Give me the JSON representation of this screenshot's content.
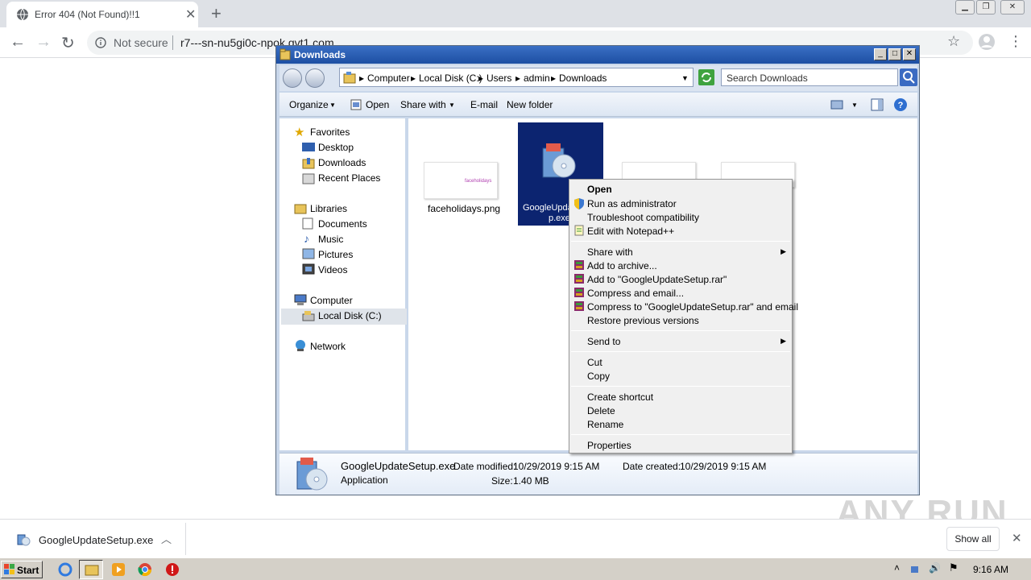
{
  "browser": {
    "tab_title": "Error 404 (Not Found)!!1",
    "tab_close": "✕",
    "new_tab": "+",
    "address": {
      "security_label": "Not secure",
      "url": "r7---sn-nu5gi0c-npok.gvt1.com"
    }
  },
  "explorer": {
    "title": "Downloads",
    "breadcrumbs": [
      "Computer",
      "Local Disk (C:)",
      "Users",
      "admin",
      "Downloads"
    ],
    "search_placeholder": "Search Downloads",
    "commands": {
      "organize": "Organize",
      "open": "Open",
      "share_with": "Share with",
      "email": "E-mail",
      "new_folder": "New folder"
    },
    "nav": {
      "favorites": "Favorites",
      "desktop": "Desktop",
      "downloads": "Downloads",
      "recent_places": "Recent Places",
      "libraries": "Libraries",
      "documents": "Documents",
      "music": "Music",
      "pictures": "Pictures",
      "videos": "Videos",
      "computer": "Computer",
      "local_disk": "Local Disk (C:)",
      "network": "Network"
    },
    "files": [
      {
        "name": "faceholidays.png",
        "thumb_text": "faceholidays"
      },
      {
        "name_line1": "GoogleUpda",
        "name_line2": "p.exe"
      }
    ],
    "details": {
      "filename": "GoogleUpdateSetup.exe",
      "type": "Application",
      "modified_label": "Date modified:",
      "modified_value": "10/29/2019 9:15 AM",
      "created_label": "Date created:",
      "created_value": "10/29/2019 9:15 AM",
      "size_label": "Size:",
      "size_value": "1.40 MB"
    }
  },
  "context_menu": {
    "open": "Open",
    "run_as_admin": "Run as administrator",
    "troubleshoot": "Troubleshoot compatibility",
    "edit_notepad": "Edit with Notepad++",
    "share_with": "Share with",
    "add_archive": "Add to archive...",
    "add_rar": "Add to \"GoogleUpdateSetup.rar\"",
    "compress_email": "Compress and email...",
    "compress_rar_email": "Compress to \"GoogleUpdateSetup.rar\" and email",
    "restore_versions": "Restore previous versions",
    "send_to": "Send to",
    "cut": "Cut",
    "copy": "Copy",
    "create_shortcut": "Create shortcut",
    "delete": "Delete",
    "rename": "Rename",
    "properties": "Properties"
  },
  "download_bar": {
    "filename": "GoogleUpdateSetup.exe",
    "show_all": "Show all"
  },
  "taskbar": {
    "start": "Start",
    "clock": "9:16 AM"
  },
  "watermark": "ANY RUN",
  "colors": {
    "selection": "#0c2470",
    "titlebar": "#1d4fa3",
    "taskbar": "#d4d0c8"
  }
}
